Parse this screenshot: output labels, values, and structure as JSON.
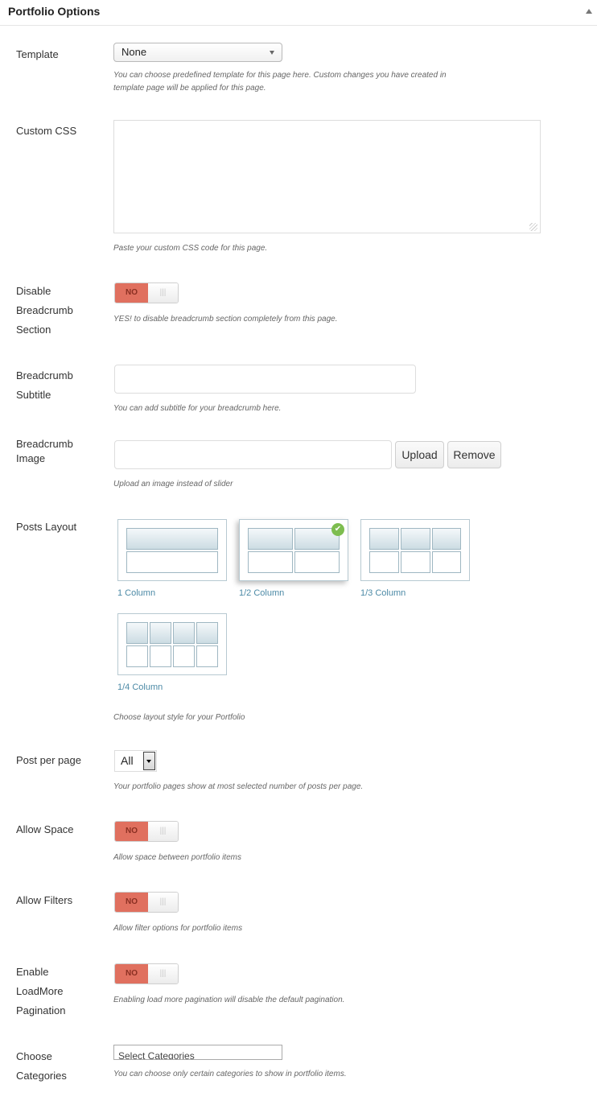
{
  "panel": {
    "title": "Portfolio Options"
  },
  "template": {
    "label": "Template",
    "selected": "None",
    "desc": "You can choose predefined template for this page here. Custom changes you have created in template page will be applied for this page."
  },
  "custom_css": {
    "label": "Custom CSS",
    "value": "",
    "desc": "Paste your custom CSS code for this page."
  },
  "disable_breadcrumb": {
    "label": "Disable Breadcrumb Section",
    "toggle": "NO",
    "grip": "|||",
    "desc": "YES! to disable breadcrumb section completely from this page."
  },
  "breadcrumb_subtitle": {
    "label": "Breadcrumb Subtitle",
    "value": "",
    "desc": "You can add subtitle for your breadcrumb here."
  },
  "breadcrumb_image": {
    "label": "Breadcrumb Image",
    "value": "",
    "upload_label": "Upload",
    "remove_label": "Remove",
    "desc": "Upload an image instead of slider"
  },
  "posts_layout": {
    "label": "Posts Layout",
    "options": [
      {
        "label": "1 Column",
        "columns": 1
      },
      {
        "label": "1/2 Column",
        "columns": 2,
        "selected": true
      },
      {
        "label": "1/3 Column",
        "columns": 3
      },
      {
        "label": "1/4 Column",
        "columns": 4
      }
    ],
    "check": "✔",
    "desc": "Choose layout style for your Portfolio"
  },
  "post_per_page": {
    "label": "Post per page",
    "selected": "All",
    "desc": "Your portfolio pages show at most selected number of posts per page."
  },
  "allow_space": {
    "label": "Allow Space",
    "toggle": "NO",
    "grip": "|||",
    "desc": "Allow space between portfolio items"
  },
  "allow_filters": {
    "label": "Allow Filters",
    "toggle": "NO",
    "grip": "|||",
    "desc": "Allow filter options for portfolio items"
  },
  "loadmore": {
    "label": "Enable LoadMore Pagination",
    "toggle": "NO",
    "grip": "|||",
    "desc": "Enabling load more pagination will disable the default pagination."
  },
  "categories": {
    "label": "Choose Categories",
    "placeholder": "Select Categories",
    "desc": "You can choose only certain categories to show in portfolio items."
  },
  "colors": {
    "toggle_no": "#e0705f",
    "link": "#4c8aa6",
    "check": "#7dbd4f",
    "card_border": "#b7c9d1"
  },
  "icons": {
    "collapse": "triangle-up-icon",
    "select_arrow": "chevron-down-icon",
    "check": "check-circle-icon",
    "resize": "resize-handle-icon"
  }
}
